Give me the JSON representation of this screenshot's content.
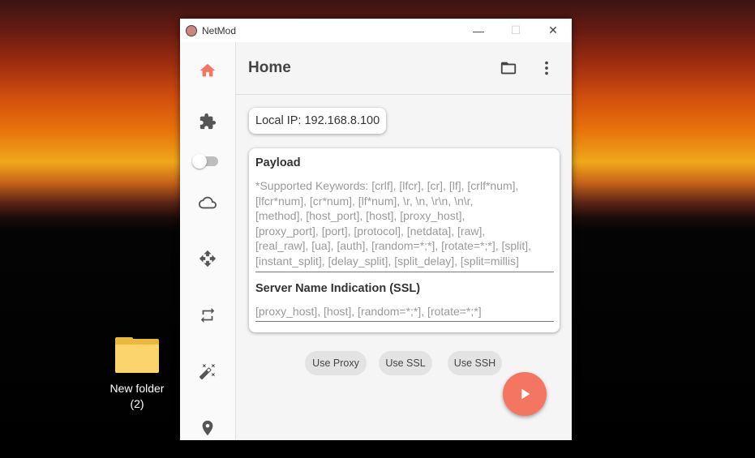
{
  "desktop": {
    "folder_label_line1": "New folder",
    "folder_label_line2": "(2)"
  },
  "window": {
    "title": "NetMod",
    "controls": {
      "minimize": "—",
      "maximize": "☐",
      "close": "✕"
    }
  },
  "sidebar": {
    "items": [
      {
        "icon": "home-icon",
        "active": true
      },
      {
        "icon": "puzzle-icon",
        "active": false,
        "toggle_on": false
      },
      {
        "icon": "cloud-icon",
        "active": false
      },
      {
        "icon": "move-icon",
        "active": false
      },
      {
        "icon": "repeat-icon",
        "active": false
      },
      {
        "icon": "magic-wand-icon",
        "active": false
      },
      {
        "icon": "location-pin-icon",
        "active": false
      }
    ],
    "active_color": "#f47560",
    "icon_color": "#555555"
  },
  "appbar": {
    "title": "Home",
    "actions": [
      "folder-icon",
      "more-vert-icon"
    ]
  },
  "local_ip": {
    "text": "Local IP: 192.168.8.100"
  },
  "payload": {
    "label": "Payload",
    "placeholder_lines": [
      "*Supported Keywords: [crlf], [lfcr], [cr], [lf], [crlf*num],",
      "[lfcr*num], [cr*num], [lf*num], \\r, \\n, \\r\\n, \\n\\r,",
      "[method], [host_port], [host], [proxy_host],",
      "[proxy_port], [port], [protocol], [netdata], [raw],",
      "[real_raw], [ua], [auth], [random=*;*], [rotate=*;*], [split],",
      "[instant_split], [delay_split], [split_delay], [split=millis]"
    ]
  },
  "sni": {
    "label": "Server Name Indication (SSL)",
    "placeholder": "[proxy_host], [host], [random=*;*], [rotate=*;*]"
  },
  "chips": {
    "use_proxy": "Use Proxy",
    "use_ssl": "Use SSL",
    "use_ssh": "Use SSH"
  },
  "fab": {
    "icon": "play-icon",
    "color": "#f47560"
  }
}
